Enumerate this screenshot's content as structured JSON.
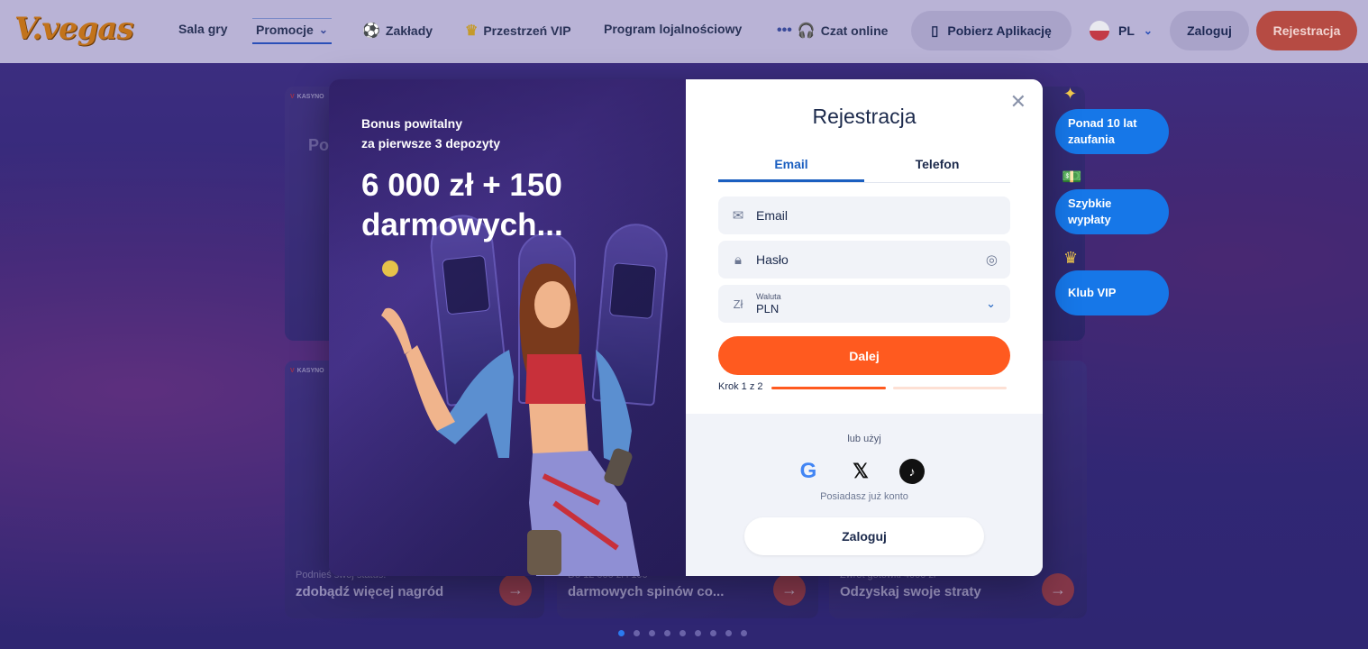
{
  "header": {
    "logo": "V.vegas",
    "nav": [
      {
        "label": "Sala gry"
      },
      {
        "label": "Promocje"
      },
      {
        "label": "Zakłady"
      },
      {
        "label": "Przestrzeń VIP"
      },
      {
        "label": "Program lojalnościowy"
      },
      {
        "label": "Czat online"
      }
    ],
    "download_app": "Pobierz Aplikację",
    "language": "PL",
    "login": "Zaloguj",
    "register": "Rejestracja"
  },
  "background_cards": [
    {
      "tag": "KASYNO",
      "big": "Po\nZ\nd",
      "subtitle": "",
      "title": ""
    },
    {
      "tag": "KASYNO",
      "subtitle": "Podnieś swój status.",
      "title": "zdobądź więcej nagród"
    },
    {
      "tag": "",
      "subtitle": "Do 12 000 zł i 100",
      "title": "darmowych spinów co..."
    },
    {
      "tag": "",
      "subtitle": "Zwrot gotówki 4000 zł",
      "title": "Odzyskaj swoje straty"
    }
  ],
  "promo": {
    "subtitle_line1": "Bonus powitalny",
    "subtitle_line2": "za pierwsze 3 depozyty",
    "title_line1": "6 000 zł + 150",
    "title_line2": "darmowych..."
  },
  "registration": {
    "title": "Rejestracja",
    "tabs": [
      {
        "label": "Email",
        "active": true
      },
      {
        "label": "Telefon",
        "active": false
      }
    ],
    "email_placeholder": "Email",
    "password_placeholder": "Hasło",
    "currency_label": "Waluta",
    "currency_symbol": "Zł",
    "currency_value": "PLN",
    "next_button": "Dalej",
    "step_text": "Krok 1 z 2",
    "step_progress": 0.5,
    "or_use": "lub użyj",
    "social": [
      "Google",
      "X",
      "TikTok"
    ],
    "have_account": "Posiadasz już konto",
    "login_button": "Zaloguj"
  },
  "badges": [
    {
      "label": "Ponad 10 lat zaufania"
    },
    {
      "label": "Szybkie wypłaty"
    },
    {
      "label": "Klub VIP"
    }
  ],
  "carousel": {
    "count": 9,
    "active_index": 0
  },
  "colors": {
    "accent": "#1b5fc0",
    "cta": "#ff5a1f",
    "badge": "#1677e8"
  }
}
